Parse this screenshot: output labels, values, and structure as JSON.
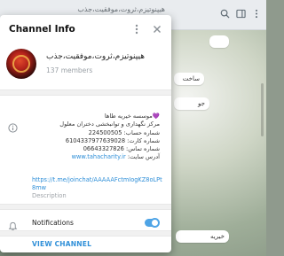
{
  "background": {
    "chat_title": "هیپنوتیزم،ثروت،موفقیت،جذب",
    "bubbles": [
      "ساخت",
      "جو",
      "خیریه"
    ]
  },
  "dialog": {
    "title": "Channel Info",
    "more_icon": "more-vertical-icon",
    "close_icon": "close-icon"
  },
  "channel": {
    "name": "هیپنوتیزم،ثروت،موفقیت،جذب",
    "members": "137 members"
  },
  "description": {
    "lines": [
      "💜موسسه خیریه طاها",
      "مرکز نگهداری و توانبخشی دختران معلول",
      "شماره حساب: 224500505",
      "شماره کارت: 6104337977639028",
      "شماره تماس: 06643327826",
      "آدرس سایت: "
    ],
    "website": "www.tahacharity.ir",
    "invite_link": "https://t.me/joinchat/AAAAAFctmIogKZ8oLPt8mw",
    "label": "Description"
  },
  "notifications": {
    "label": "Notifications",
    "enabled": true
  },
  "actions": {
    "view_channel": "VIEW CHANNEL"
  },
  "colors": {
    "accent": "#2f8fd8",
    "toggle": "#4ea4e6",
    "heart": "#7b2fc4"
  }
}
